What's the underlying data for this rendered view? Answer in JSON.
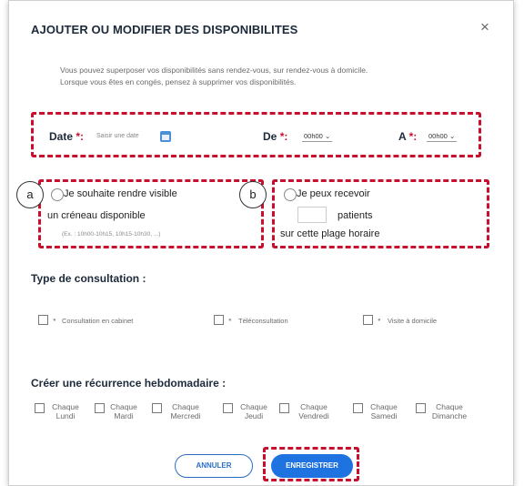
{
  "modal": {
    "title": "AJOUTER OU MODIFIER DES DISPONIBILITES",
    "close_glyph": "×",
    "intro_line1": "Vous pouvez superposer vos disponibilités sans rendez-vous, sur rendez-vous à domicile.",
    "intro_line2": "Lorsque vous êtes en congés, pensez à supprimer vos disponibilités."
  },
  "date_row": {
    "date_label": "Date",
    "date_required": "*:",
    "date_placeholder": "Saisir une date",
    "from_label": "De",
    "from_required": "*:",
    "from_value": "00h00",
    "to_label": "A",
    "to_required": "*:",
    "to_value": "00h00"
  },
  "annotations": {
    "a": "a",
    "b": "b"
  },
  "option_a": {
    "line1": "Je souhaite rendre visible",
    "line2": "un créneau disponible",
    "example": "(Ex. : 10h00-10h15, 10h15-10h30, ...)"
  },
  "option_b": {
    "line1": "Je peux recevoir",
    "patients": "patients",
    "line3": "sur cette plage horaire"
  },
  "consultation": {
    "title": "Type de consultation :",
    "types": [
      "Consultation en cabinet",
      "Téléconsultation",
      "Visite à domicile"
    ]
  },
  "recurrence": {
    "title": "Créer une récurrence hebdomadaire :",
    "days": [
      [
        "Chaque",
        "Lundi"
      ],
      [
        "Chaque",
        "Mardi"
      ],
      [
        "Chaque",
        "Mercredi"
      ],
      [
        "Chaque",
        "Jeudi"
      ],
      [
        "Chaque",
        "Vendredi"
      ],
      [
        "Chaque",
        "Samedi"
      ],
      [
        "Chaque",
        "Dimanche"
      ]
    ]
  },
  "buttons": {
    "cancel": "ANNULER",
    "save": "ENREGISTRER"
  },
  "colors": {
    "highlight": "#c8102e",
    "primary": "#1e73e0",
    "title": "#1d2a3a"
  },
  "icons": {
    "calendar": "calendar-icon",
    "close": "close-icon",
    "chevron": "chevron-down-icon"
  }
}
